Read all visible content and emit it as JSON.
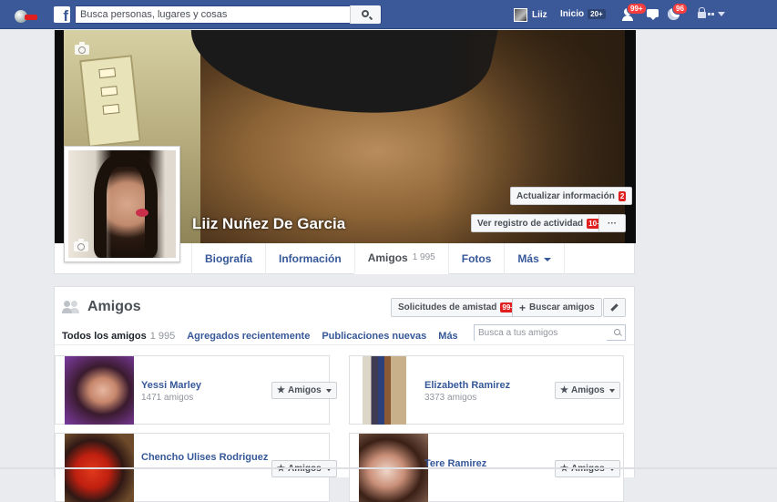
{
  "topbar": {
    "search_placeholder": "Busca personas, lugares y cosas",
    "user_name": "Liiz",
    "home_label": "Inicio",
    "home_count": "20+",
    "friend_requests_badge": "99+",
    "notifications_badge": "96"
  },
  "profile": {
    "name": "Liiz Nuñez De Garcia",
    "update_info_label": "Actualizar información",
    "update_info_badge": "2",
    "activity_log_label": "Ver registro de actividad",
    "activity_log_badge": "10+",
    "more_options_label": "···",
    "tabs": [
      {
        "label": "Biografía",
        "count": ""
      },
      {
        "label": "Información",
        "count": ""
      },
      {
        "label": "Amigos",
        "count": "1 995"
      },
      {
        "label": "Fotos",
        "count": ""
      },
      {
        "label": "Más",
        "count": ""
      }
    ]
  },
  "friends_section": {
    "title": "Amigos",
    "requests_label": "Solicitudes de amistad",
    "requests_badge": "99+",
    "find_friends_label": "Buscar amigos",
    "subnav": [
      {
        "label": "Todos los amigos",
        "count": "1 995"
      },
      {
        "label": "Agregados recientemente",
        "count": ""
      },
      {
        "label": "Publicaciones nuevas",
        "count": ""
      },
      {
        "label": "Más",
        "count": ""
      }
    ],
    "search_placeholder": "Busca a tus amigos",
    "friend_button_label": "Amigos",
    "friends": [
      {
        "name": "Yessi Marley",
        "mutual": "1471 amigos"
      },
      {
        "name": "Elizabeth Ramirez",
        "mutual": "3373 amigos"
      },
      {
        "name": "Chencho Ulises Rodriguez",
        "mutual": ""
      },
      {
        "name": "Tere Ramirez",
        "mutual": ""
      }
    ]
  },
  "colors": {
    "brand": "#3b5998",
    "link": "#365899",
    "badge": "#fa3e3e"
  }
}
